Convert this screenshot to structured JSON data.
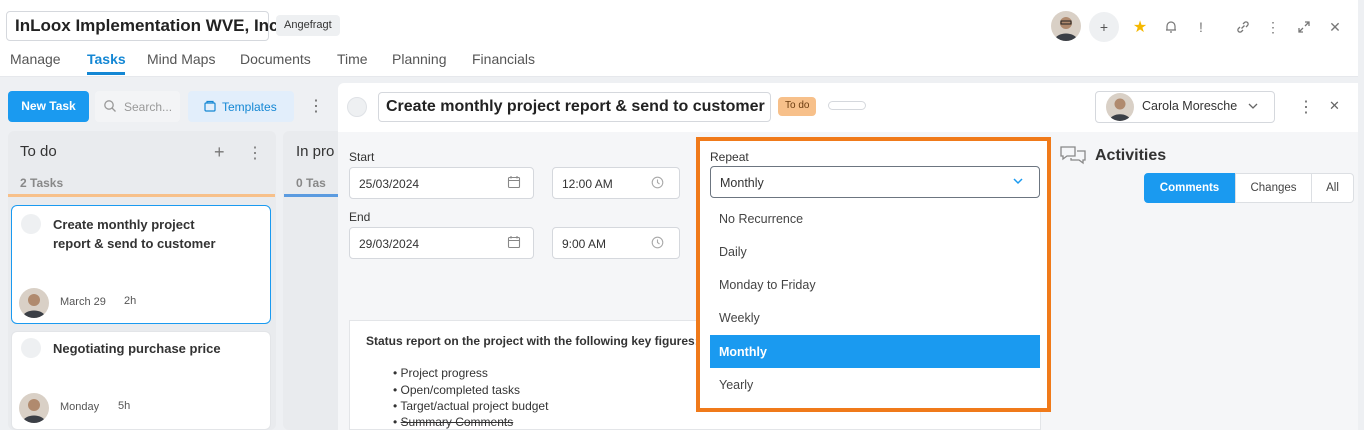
{
  "header": {
    "project_title": "InLoox Implementation WVE, Inc.",
    "project_status": "Angefragt",
    "nav_tabs": [
      "Manage",
      "Tasks",
      "Mind Maps",
      "Documents",
      "Time",
      "Planning",
      "Financials"
    ],
    "active_tab": "Tasks",
    "add_label": "+",
    "alert_label": "!"
  },
  "toolbar": {
    "new_task_label": "New Task",
    "search_placeholder": "Search...",
    "templates_label": "Templates"
  },
  "columns": [
    {
      "title": "To do",
      "count": "2 Tasks"
    },
    {
      "title": "In pro",
      "count": "0 Tas"
    }
  ],
  "cards": [
    {
      "title": "Create monthly project report & send to customer",
      "date": "March 29",
      "duration": "2h"
    },
    {
      "title": "Negotiating purchase price",
      "date": "Monday",
      "duration": "5h"
    }
  ],
  "detail": {
    "task_title": "Create monthly project report & send to customer",
    "status": "To do",
    "assignee": "Carola Moresche",
    "start_label": "Start",
    "start_date": "25/03/2024",
    "start_time": "12:00 AM",
    "end_label": "End",
    "end_date": "29/03/2024",
    "end_time": "9:00 AM",
    "description": {
      "heading": "Status report on the project with the following key figures:",
      "bullets": [
        "Project progress",
        "Open/completed tasks",
        "Target/actual project budget",
        "Summary Comments"
      ]
    }
  },
  "repeat": {
    "label": "Repeat",
    "value": "Monthly",
    "options": [
      "No Recurrence",
      "Daily",
      "Monday to Friday",
      "Weekly",
      "Monthly",
      "Yearly"
    ],
    "selected": "Monthly"
  },
  "activities": {
    "title": "Activities",
    "tabs": [
      "Comments",
      "Changes",
      "All"
    ],
    "active_tab": "Comments"
  },
  "colors": {
    "accent": "#1a9af0",
    "highlight": "#f07a1a",
    "status_todo": "#f7c08a"
  }
}
